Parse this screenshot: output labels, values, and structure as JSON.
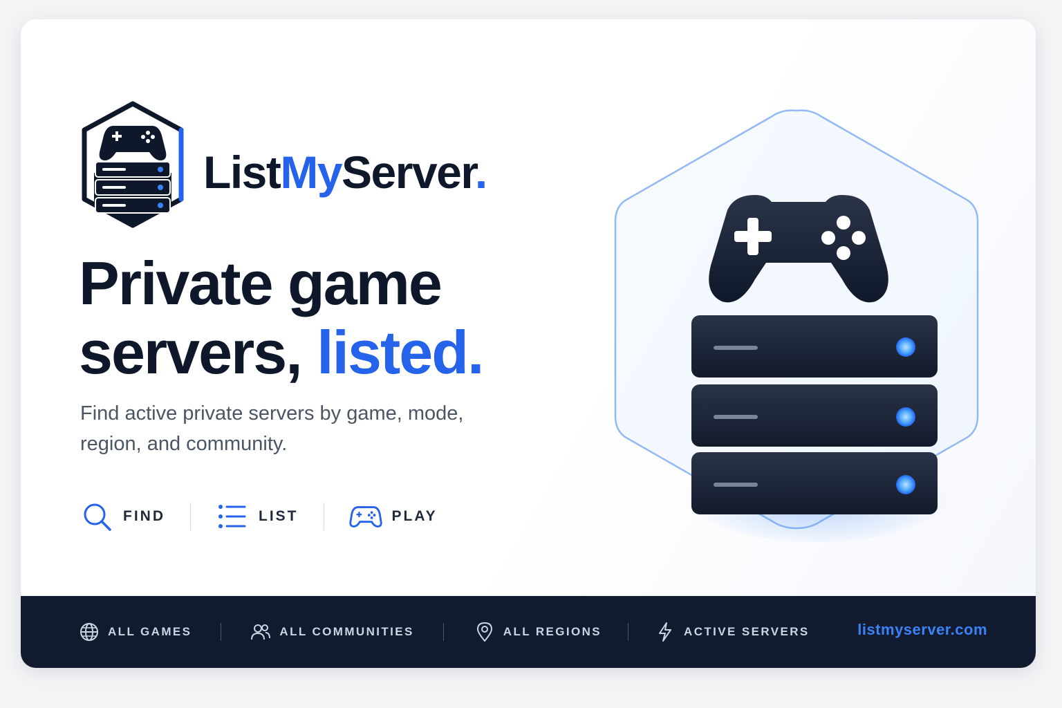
{
  "brand": {
    "name_prefix": "List",
    "name_accent": "My",
    "name_suffix": "Server",
    "name_dot": ".",
    "accent_color": "#2563eb",
    "dark_color": "#0f172a"
  },
  "hero": {
    "headline_line1": "Private game",
    "headline_line2": "servers,",
    "headline_accent": "listed.",
    "subtitle": "Find active private servers by game, mode, region, and community."
  },
  "features": [
    {
      "icon": "search-icon",
      "label": "FIND"
    },
    {
      "icon": "list-icon",
      "label": "LIST"
    },
    {
      "icon": "gamepad-icon",
      "label": "PLAY"
    }
  ],
  "footer": {
    "items": [
      {
        "icon": "globe-icon",
        "label": "ALL GAMES"
      },
      {
        "icon": "users-icon",
        "label": "ALL COMMUNITIES"
      },
      {
        "icon": "location-pin-icon",
        "label": "ALL REGIONS"
      },
      {
        "icon": "lightning-icon",
        "label": "ACTIVE SERVERS"
      }
    ],
    "url": "listmyserver.com",
    "background": "#111a2e",
    "url_color": "#3b82f6"
  }
}
